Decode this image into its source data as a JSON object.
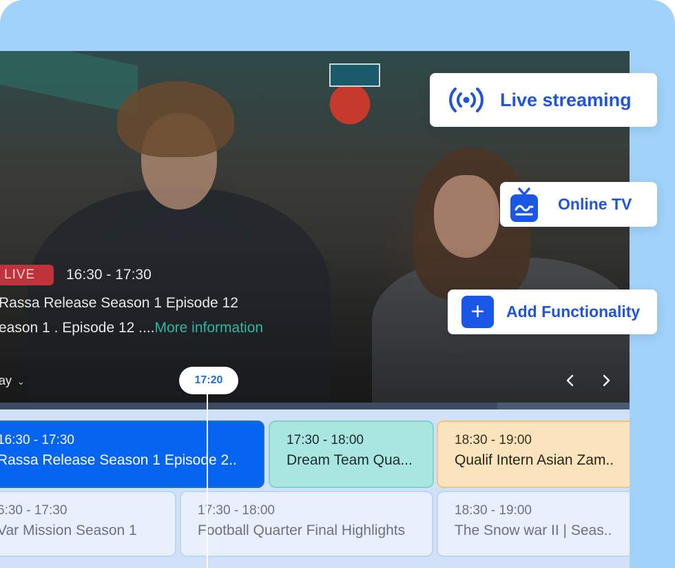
{
  "player": {
    "live_badge": "LIVE",
    "time_range": "16:30 - 17:30",
    "episode_title": "Rassa Release Season 1 Episode 12",
    "episode_subtitle": "eason 1 .  Episode 12 ....",
    "more_link": "More information",
    "day_select": "ay",
    "progress_fraction": 0.79
  },
  "timeline": {
    "current_time": "17:20"
  },
  "guide": {
    "row1": [
      {
        "time": "16:30 - 17:30",
        "title": "Rassa Release Season 1 Episode 2.."
      },
      {
        "time": "17:30 - 18:00",
        "title": "Dream Team Qua..."
      },
      {
        "time": "18:30 - 19:00",
        "title": "Qualif Intern Asian Zam.."
      }
    ],
    "row2": [
      {
        "time": "6:30 - 17:30",
        "title": "Var Mission Season 1"
      },
      {
        "time": "17:30 - 18:00",
        "title": "Football Quarter Final Highlights"
      },
      {
        "time": "18:30 - 19:00",
        "title": "The Snow war II | Seas.."
      }
    ]
  },
  "callouts": {
    "live_streaming": "Live streaming",
    "online_tv": "Online TV",
    "add_functionality": "Add Functionality"
  },
  "colors": {
    "accent_blue": "#1f56d9",
    "active_program": "#0565f0",
    "live_red": "#c0323c",
    "link_teal": "#2fb7a4",
    "background": "#a1d2f9"
  },
  "icons": {
    "live_streaming": "broadcast-icon",
    "online_tv": "tv-icon",
    "add_functionality": "plus-icon",
    "prev": "chevron-left-icon",
    "next": "chevron-right-icon",
    "day_dropdown": "chevron-down-icon"
  }
}
